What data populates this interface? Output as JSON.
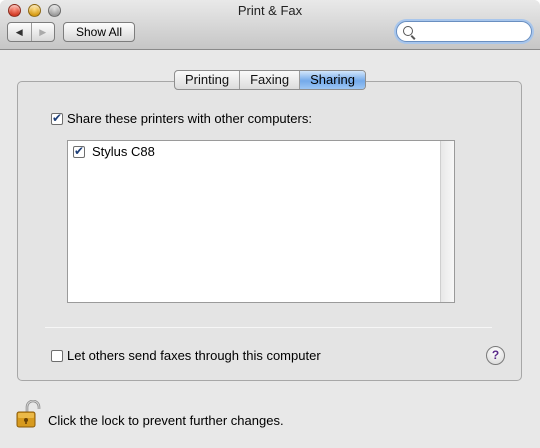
{
  "window": {
    "title": "Print & Fax"
  },
  "toolbar": {
    "back_label": "◀",
    "forward_label": "▶",
    "show_all_label": "Show All",
    "search": {
      "value": "",
      "placeholder": ""
    }
  },
  "tabs": [
    {
      "label": "Printing",
      "active": false
    },
    {
      "label": "Faxing",
      "active": false
    },
    {
      "label": "Sharing",
      "active": true
    }
  ],
  "sharing": {
    "share_printers": {
      "label": "Share these printers with other computers:",
      "checked": true
    },
    "printers": [
      {
        "name": "Stylus C88",
        "checked": true
      }
    ],
    "fax_sharing": {
      "label": "Let others send faxes through this computer",
      "checked": false
    }
  },
  "help_label": "?",
  "lock": {
    "label": "Click the lock to prevent further changes.",
    "state": "unlocked",
    "icon": "open-padlock-icon"
  }
}
